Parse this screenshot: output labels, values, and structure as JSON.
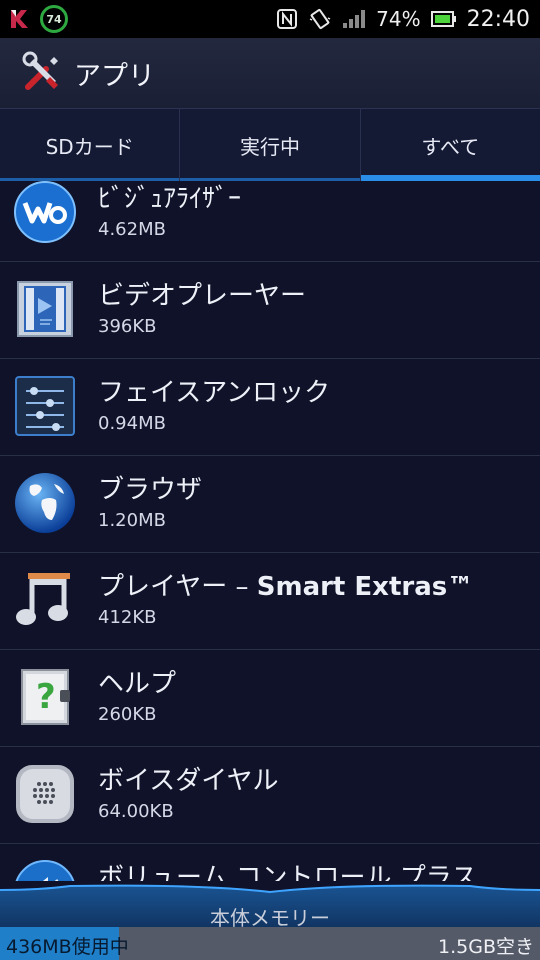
{
  "status_bar": {
    "badge": "74",
    "battery": "74%",
    "time": "22:40"
  },
  "action_bar": {
    "title": "アプリ"
  },
  "tabs": [
    {
      "label": "SDカード",
      "active": false
    },
    {
      "label": "実行中",
      "active": false
    },
    {
      "label": "すべて",
      "active": true
    }
  ],
  "apps": [
    {
      "name": "ﾋﾞｼﾞｭｱﾗｲｻﾞｰ",
      "size": "4.62MB",
      "icon": "walkman-icon"
    },
    {
      "name": "ビデオプレーヤー",
      "size": "396KB",
      "icon": "video-player-icon"
    },
    {
      "name": "フェイスアンロック",
      "size": "0.94MB",
      "icon": "face-unlock-icon"
    },
    {
      "name": "ブラウザ",
      "size": "1.20MB",
      "icon": "browser-globe-icon"
    },
    {
      "name": "プレイヤー – Smart Extras™",
      "size": "412KB",
      "icon": "music-note-icon"
    },
    {
      "name": "ヘルプ",
      "size": "260KB",
      "icon": "help-icon"
    },
    {
      "name": "ボイスダイヤル",
      "size": "64.00KB",
      "icon": "voice-dial-icon"
    },
    {
      "name": "ボリューム コントロール プラス",
      "size": "",
      "icon": "volume-icon"
    }
  ],
  "storage": {
    "label": "本体メモリー",
    "used": "436MB使用中",
    "free": "1.5GB空き",
    "used_fraction": 0.22
  },
  "colors": {
    "accent": "#2a8ee8",
    "background": "#0f1228"
  }
}
